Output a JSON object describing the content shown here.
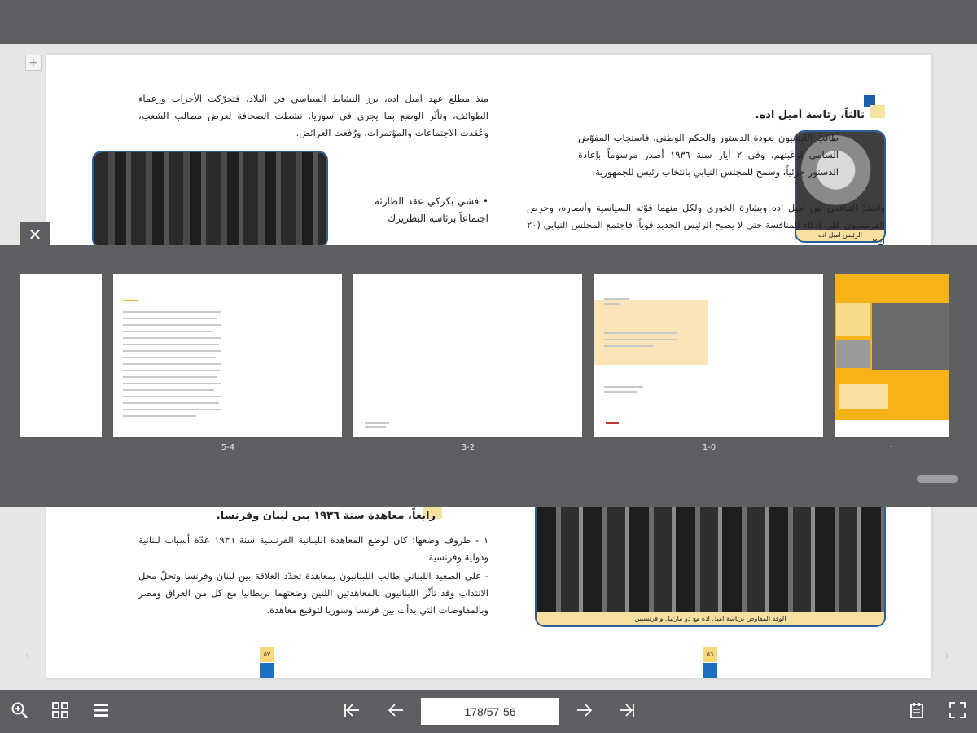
{
  "viewer": {
    "page_indicator": "178/57-56"
  },
  "left_page": {
    "intro_paragraph": "منذ مطلع عهد اميل اده، برز النشاط السياسي في البلاد، فتحرّكت الأحزاب وزعماء الطوائف، وتأثّر الوضع بما يجري في سوريا. نشطت الصحافة لعرض مطالب الشعب، وعُقدت الاجتماعات والمؤتمرات، ورُفعت العرائض.",
    "bullet_text": "• فشي بكركي عقد الطارئة اجتماعاً برئاسة البطريرك",
    "section4_heading": "رابعاً، معاهدة سنة ١٩٣٦ بين لبنان وفرنسا.",
    "para1": "١ - ظروف وضعها: كان لوضع المعاهدة اللبنانية الفرنسية سنة ١٩٣٦ عدّة أسباب لبنانية ودولية وفرنسية:",
    "para2": "- على الصعيد اللبناني طالب اللبنانيون بمعاهدة تحدّد العلاقة بين لبنان وفرنسا وتحلّ محل الانتداب وقد تأثّر اللبنانيون بالمعاهدتين اللتين وضعتهما بريطانيا مع كل من العراق ومصر وبالمفاوضات التي بدأت بين فرنسا وسوريا لتوقيع معاهدة.",
    "page_number": "٥٧"
  },
  "right_page": {
    "section3_heading": "ثالثاً، رئاسة أميل اده.",
    "para1": "طالبَ اللبنانيون بعودة الدستور والحكم الوطني، فاستجاب المفوّض السامي لرغبتهم، وفي ٢ أيار سنة ١٩٣٦ أصدر مرسوماً بإعادة الدستور جزئياً، وسمح للمجلس النيابي بانتخاب رئيس للجمهورية.",
    "para2": "واشتدّ التنافس بين اميل اده وبشارة الخوري ولكل منهما قوّته السياسية وأنصاره، وحرص الفرنسيون على إذكاء المنافسة حتى لا يصبح الرئيس الجديد قوياً، فاجتمع المجلس النيابي (٢٠ ك٢",
    "portrait_caption": "الرئيس اميل اده",
    "bottom_photo_caption": "الوفد المفاوض برئاسة اميل اده مع دو مارتيل و فرنسيين",
    "page_number": "٥٦"
  },
  "thumbnails": [
    {
      "label": "",
      "kind": "partial-blank"
    },
    {
      "label": "5-4",
      "kind": "text-page"
    },
    {
      "label": "3-2",
      "kind": "blank-page"
    },
    {
      "label": "1-0",
      "kind": "title-page"
    },
    {
      "label": "·",
      "kind": "cover"
    }
  ],
  "colors": {
    "chrome": "#5e5f62",
    "accent_blue": "#1d5fa8",
    "accent_yellow": "#f7e3a0",
    "cover_orange": "#f5b318"
  },
  "icons": {
    "close": "close-icon",
    "zoom": "zoom-in-icon",
    "grid": "grid-icon",
    "list": "list-icon",
    "first": "first-page-icon",
    "prev": "previous-page-icon",
    "next": "next-page-icon",
    "last": "last-page-icon",
    "notes": "notes-icon",
    "fullscreen": "fullscreen-icon"
  }
}
